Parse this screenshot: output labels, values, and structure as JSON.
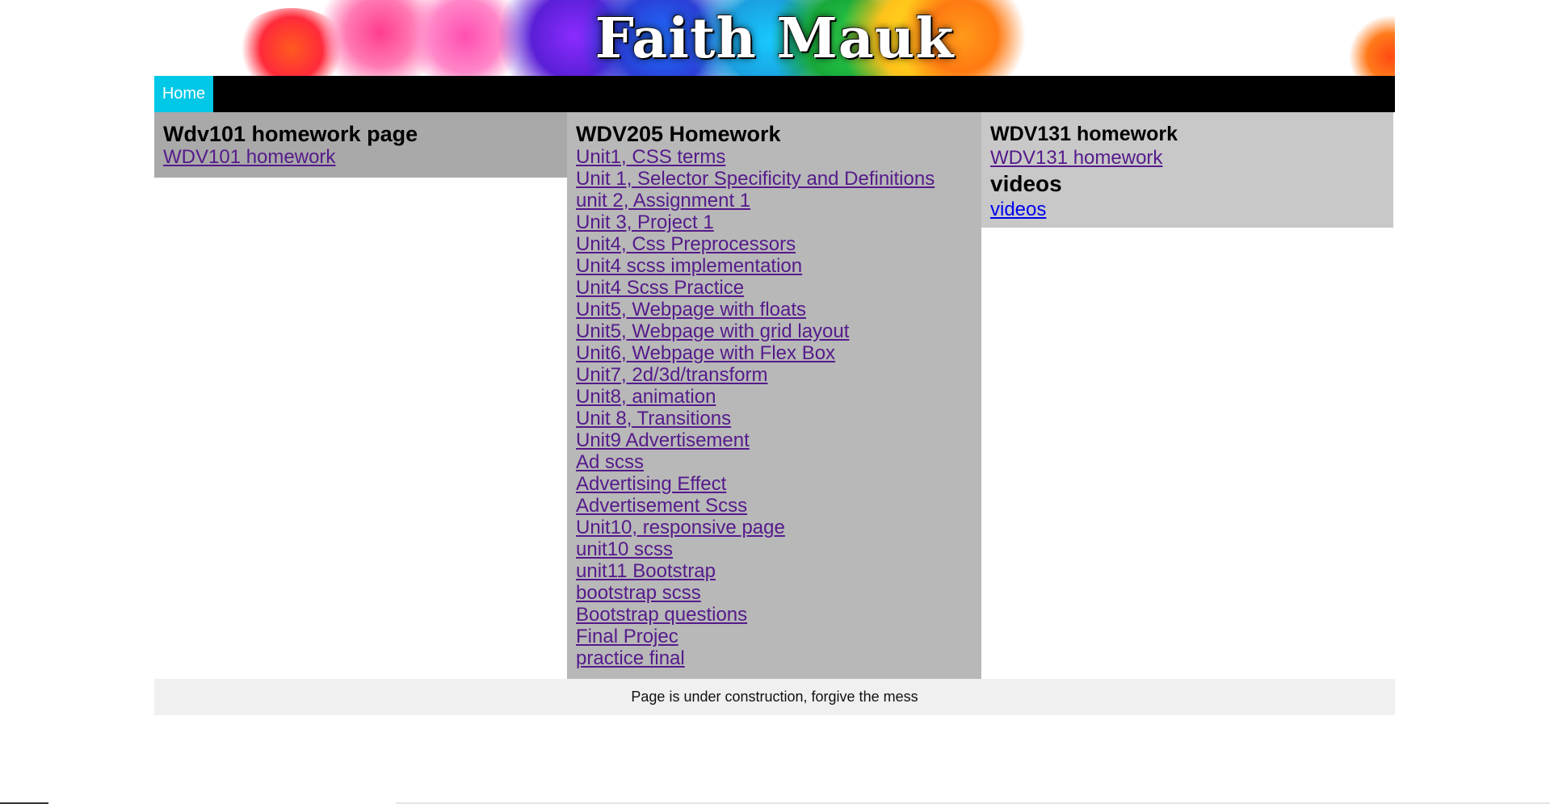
{
  "banner": {
    "title": "Faith Mauk"
  },
  "nav": {
    "items": [
      {
        "label": "Home"
      }
    ]
  },
  "left_column": {
    "heading": "Wdv101 homework page",
    "links": [
      "WDV101 homework"
    ]
  },
  "middle_column": {
    "heading": "WDV205 Homework",
    "links": [
      "Unit1, CSS terms",
      "Unit 1, Selector Specificity and Definitions",
      "unit 2, Assignment 1",
      "Unit 3, Project 1",
      "Unit4, Css Preprocessors",
      "Unit4 scss implementation",
      "Unit4 Scss Practice",
      "Unit5, Webpage with floats",
      "Unit5, Webpage with grid layout",
      "Unit6, Webpage with Flex Box",
      "Unit7, 2d/3d/transform",
      "Unit8, animation",
      "Unit 8, Transitions",
      "Unit9 Advertisement",
      "Ad scss",
      "Advertising Effect",
      "Advertisement Scss",
      "Unit10, responsive page",
      "unit10 scss",
      "unit11 Bootstrap",
      "bootstrap scss",
      "Bootstrap questions",
      "Final Projec",
      "practice final"
    ]
  },
  "right_column": {
    "heading": "WDV131 homework",
    "link": "WDV131 homework",
    "videos_heading": "videos",
    "videos_link": "videos"
  },
  "footer": {
    "text": "Page is under construction, forgive the mess"
  },
  "colors": {
    "nav_active": "#00c8e6",
    "nav_bar": "#000000",
    "visited_link": "#551a8b",
    "unvisited_link": "#0000ee",
    "left_column_bg": "#a9a9a9",
    "middle_column_bg": "#b8b8b8",
    "right_column_bg": "#c8c8c8",
    "footer_bg": "#f0f0f0"
  }
}
